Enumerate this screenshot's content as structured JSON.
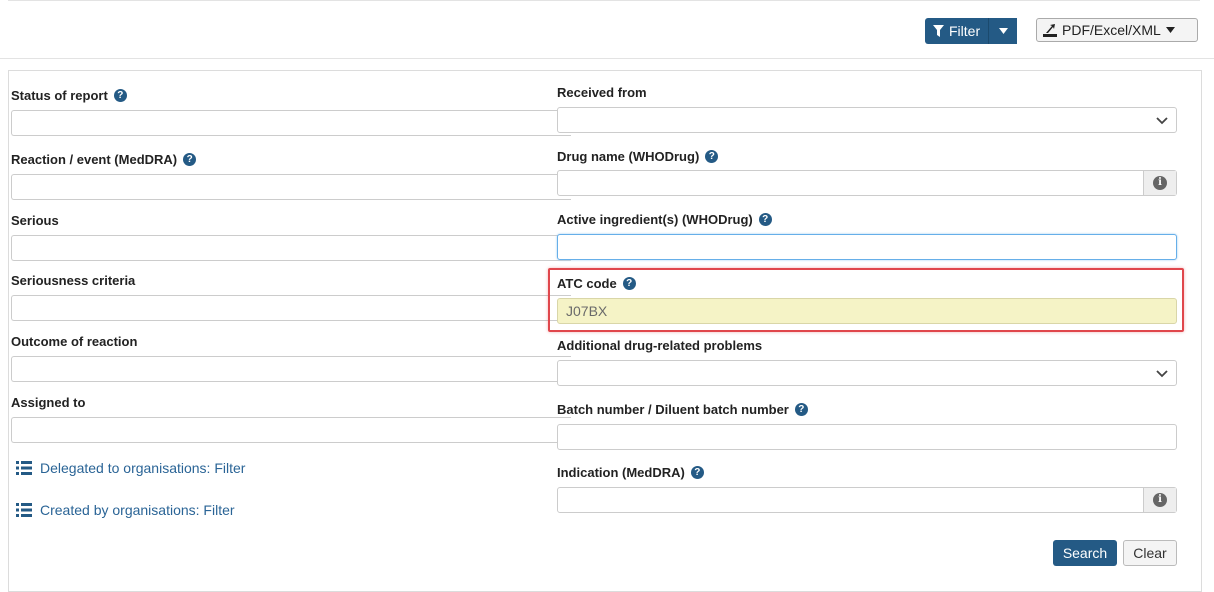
{
  "toolbar": {
    "filter_label": "Filter",
    "export_label": "PDF/Excel/XML"
  },
  "left_column": {
    "status_of_report": {
      "label": "Status of report",
      "value": ""
    },
    "reaction_event": {
      "label": "Reaction / event (MedDRA)",
      "value": ""
    },
    "serious": {
      "label": "Serious",
      "value": ""
    },
    "seriousness_criteria": {
      "label": "Seriousness criteria",
      "value": ""
    },
    "outcome_of_reaction": {
      "label": "Outcome of reaction",
      "value": ""
    },
    "assigned_to": {
      "label": "Assigned to",
      "value": ""
    },
    "delegated_link": "Delegated to organisations: Filter",
    "created_link": "Created by organisations: Filter"
  },
  "right_column": {
    "received_from": {
      "label": "Received from",
      "value": ""
    },
    "drug_name": {
      "label": "Drug name (WHODrug)",
      "value": ""
    },
    "active_ingredients": {
      "label": "Active ingredient(s) (WHODrug)",
      "value": ""
    },
    "atc_code": {
      "label": "ATC code",
      "value": "J07BX"
    },
    "additional_problems": {
      "label": "Additional drug-related problems",
      "value": ""
    },
    "batch_number": {
      "label": "Batch number / Diluent batch number",
      "value": ""
    },
    "indication": {
      "label": "Indication (MedDRA)",
      "value": ""
    }
  },
  "actions": {
    "search_label": "Search",
    "clear_label": "Clear"
  },
  "colors": {
    "primary": "#245a85",
    "highlight_border": "#e0474c",
    "atc_field_bg": "#f5f3c6",
    "link": "#2a6496"
  },
  "icons": {
    "help": "question-circle-icon",
    "info": "info-circle-icon",
    "filter": "filter-icon",
    "export": "export-icon",
    "list": "list-icon",
    "dropdown": "chevron-down-icon"
  }
}
